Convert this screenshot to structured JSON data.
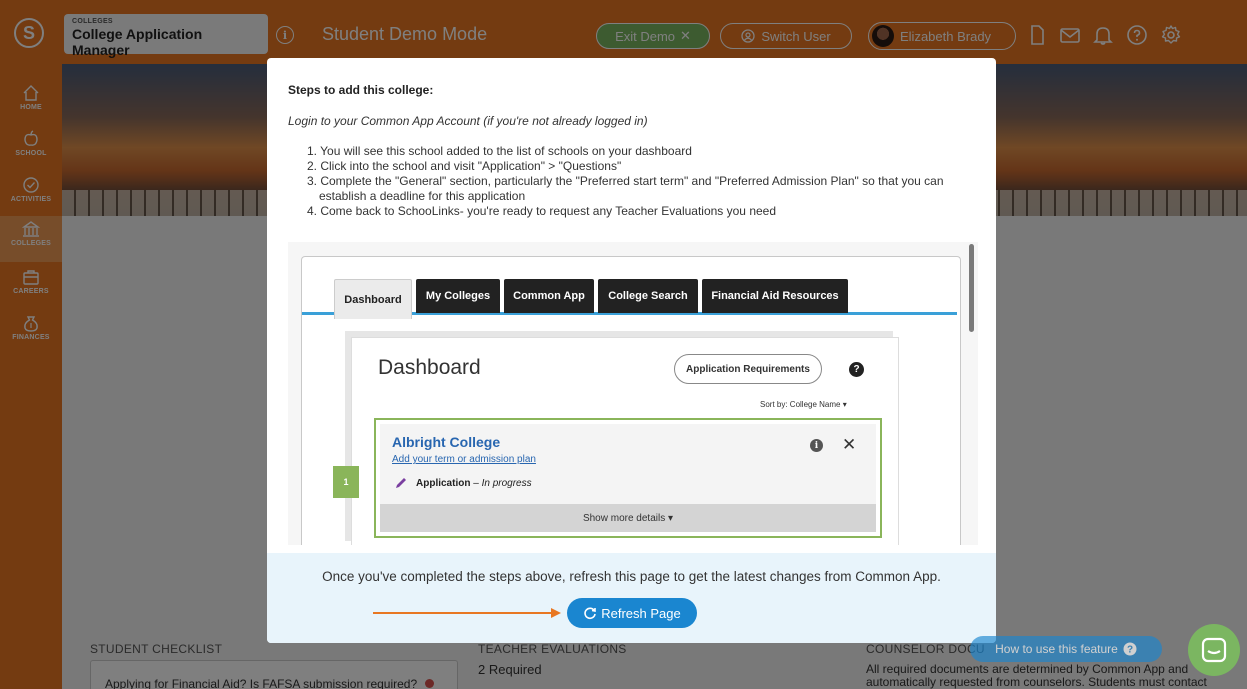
{
  "topbar": {
    "logo_letter": "S",
    "app_category": "COLLEGES",
    "app_name": "College Application Manager",
    "info_glyph": "i",
    "demo_mode_title": "Student Demo Mode",
    "exit_demo_label": "Exit Demo",
    "switch_user_label": "Switch User",
    "user_name": "Elizabeth Brady",
    "icons": [
      "document-icon",
      "mail-icon",
      "bell-icon",
      "help-icon",
      "gear-icon"
    ]
  },
  "sidebar": {
    "items": [
      {
        "label": "HOME",
        "icon": "home-icon"
      },
      {
        "label": "SCHOOL",
        "icon": "apple-icon"
      },
      {
        "label": "ACTIVITIES",
        "icon": "check-circle-icon"
      },
      {
        "label": "COLLEGES",
        "icon": "college-icon",
        "active": true
      },
      {
        "label": "CAREERS",
        "icon": "briefcase-icon"
      },
      {
        "label": "FINANCES",
        "icon": "money-bag-icon"
      }
    ]
  },
  "background": {
    "checklist_label": "STUDENT CHECKLIST",
    "checklist_item": "Applying for Financial Aid? Is FAFSA submission required?",
    "teacher_eval_label": "TEACHER EVALUATIONS",
    "teacher_eval_count": "2 Required",
    "counselor_label": "COUNSELOR DOCU",
    "counselor_text_1": "All required documents are determined by Common App and",
    "counselor_text_2": "automatically requested from counselors. Students must contact"
  },
  "modal": {
    "title": "Steps to add this college:",
    "login_line": "Login to your Common App Account (if you're not already logged in)",
    "steps": [
      "1. You will see this school added to the list of schools on your dashboard",
      "2. Click into the school and visit \"Application\" > \"Questions\"",
      "3. Complete the \"General\" section, particularly the \"Preferred start term\" and \"Preferred Admission Plan\" so that you can",
      "establish a deadline for this application",
      "4. Come back to SchooLinks- you're ready to request any Teacher Evaluations you need"
    ],
    "preview": {
      "tabs": [
        "Dashboard",
        "My Colleges",
        "Common App",
        "College Search",
        "Financial Aid Resources"
      ],
      "active_tab": "Dashboard",
      "dashboard_title": "Dashboard",
      "requirements_button": "Application Requirements",
      "help_glyph": "?",
      "sort_label": "Sort by: College Name",
      "college_name": "Albright College",
      "add_term_link": "Add your term or admission plan",
      "info_glyph": "i",
      "close_glyph": "✕",
      "application_label": "Application",
      "application_status": "In progress",
      "show_more": "Show more details",
      "step_number": "1"
    },
    "footer_text": "Once you've completed the steps above, refresh this page to get the latest changes from Common App.",
    "refresh_button": "Refresh Page"
  },
  "widgets": {
    "howto_label": "How to use this feature"
  },
  "colors": {
    "brand_orange": "#e87722",
    "demo_green": "#7bb661",
    "link_blue": "#2866b0",
    "button_blue": "#1a86d0",
    "card_green": "#8ab55a"
  }
}
